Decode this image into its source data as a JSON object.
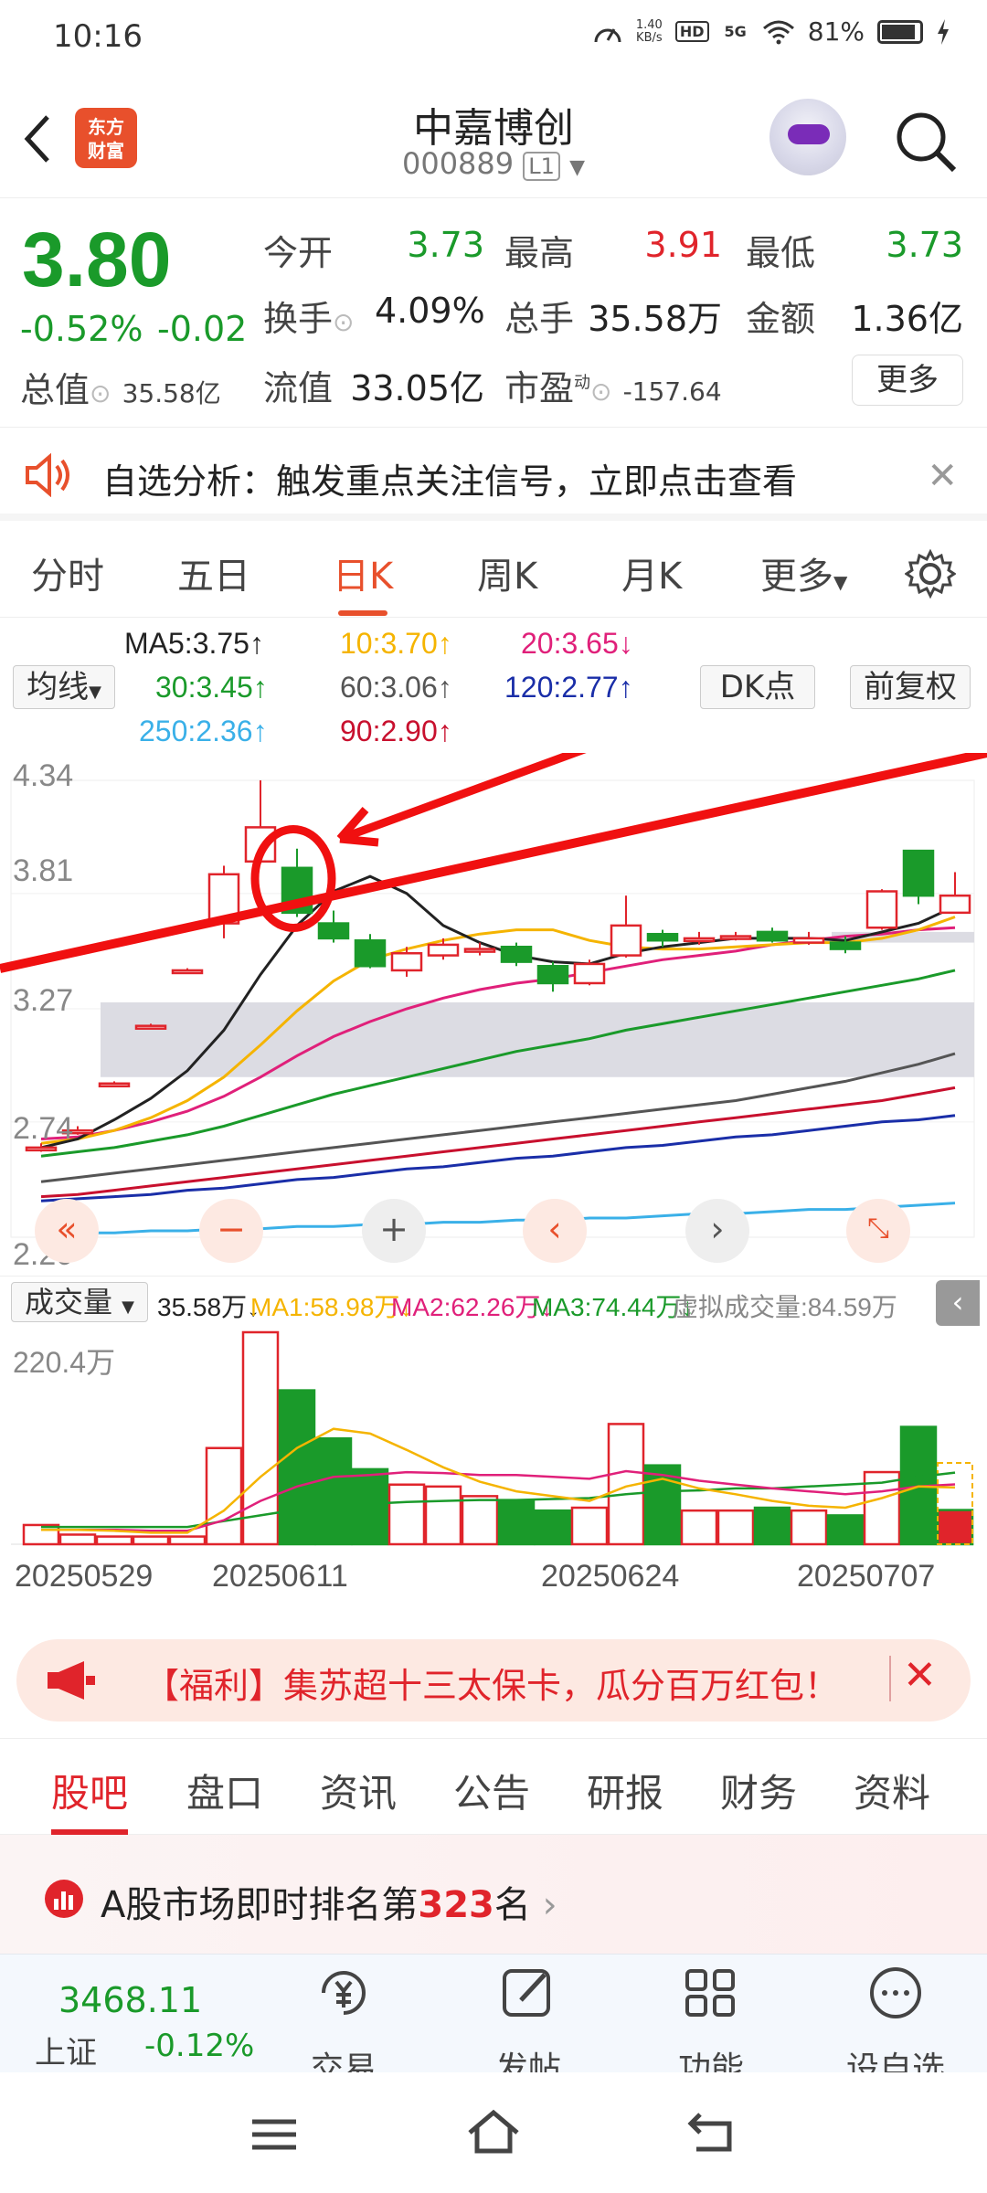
{
  "status": {
    "time": "10:16",
    "net_speed": "1.40",
    "net_unit": "KB/s",
    "hd": "HD",
    "signal": "5G",
    "battery": "81%"
  },
  "header": {
    "logo": "东方财富",
    "name": "中嘉博创",
    "code": "000889",
    "level": "L1"
  },
  "quote": {
    "price": "3.80",
    "change_pct": "-0.52%",
    "change": "-0.02",
    "open_label": "今开",
    "open": "3.73",
    "high_label": "最高",
    "high": "3.91",
    "low_label": "最低",
    "low": "3.73",
    "turnover_label": "换手",
    "turnover": "4.09%",
    "volume_label": "总手",
    "volume": "35.58万",
    "amount_label": "金额",
    "amount": "1.36亿",
    "mktcap_label": "总值",
    "mktcap": "35.58亿",
    "float_label": "流值",
    "float": "33.05亿",
    "pe_label": "市盈",
    "pe_sup": "动",
    "pe": "-157.64",
    "more": "更多"
  },
  "alert": {
    "text": "自选分析：触发重点关注信号，立即点击查看"
  },
  "ktabs": [
    "分时",
    "五日",
    "日K",
    "周K",
    "月K",
    "更多"
  ],
  "ktab_active": "日K",
  "ma_legend": {
    "selector": "均线",
    "ma5": "MA5:3.75↑",
    "ma10": "10:3.70↑",
    "ma20": "20:3.65↓",
    "ma30": "30:3.45↑",
    "ma60": "60:3.06↑",
    "ma120": "120:2.77↑",
    "ma250": "250:2.36↑",
    "ma90": "90:2.90↑",
    "dk": "DK点",
    "fq": "前复权"
  },
  "colors": {
    "up": "#e0242b",
    "down": "#1a9a2a",
    "ma5": "#222222",
    "ma10": "#f5b400",
    "ma20": "#e0207a",
    "ma30": "#1a9a2a",
    "ma60": "#555555",
    "ma120": "#1a2ea8",
    "ma250": "#3ab0e8",
    "ma90": "#c8102e"
  },
  "price_axis": [
    "4.34",
    "3.81",
    "3.27",
    "2.74",
    "2.20"
  ],
  "volume_bar": {
    "selector": "成交量",
    "vol": "35.58万↓",
    "ma1": "MA1:58.98万↓",
    "ma2": "MA2:62.26万↓",
    "ma3": "MA3:74.44万↓",
    "virtual": "虚拟成交量:84.59万"
  },
  "volume_axis": "220.4万",
  "dates": [
    "20250529",
    "20250611",
    "20250624",
    "20250707"
  ],
  "chart_data": {
    "type": "candlestick",
    "ylim": [
      2.2,
      4.34
    ],
    "candles": [
      {
        "o": 2.62,
        "c": 2.62,
        "h": 2.64,
        "l": 2.6
      },
      {
        "o": 2.7,
        "c": 2.7,
        "h": 2.72,
        "l": 2.68
      },
      {
        "o": 2.92,
        "c": 2.92,
        "h": 2.93,
        "l": 2.91
      },
      {
        "o": 3.19,
        "c": 3.19,
        "h": 3.2,
        "l": 3.18
      },
      {
        "o": 3.45,
        "c": 3.45,
        "h": 3.46,
        "l": 3.44
      },
      {
        "o": 3.67,
        "c": 3.9,
        "h": 3.94,
        "l": 3.6
      },
      {
        "o": 3.96,
        "c": 4.12,
        "h": 4.34,
        "l": 3.95
      },
      {
        "o": 3.93,
        "c": 3.72,
        "h": 4.02,
        "l": 3.7
      },
      {
        "o": 3.67,
        "c": 3.6,
        "h": 3.73,
        "l": 3.58
      },
      {
        "o": 3.59,
        "c": 3.47,
        "h": 3.62,
        "l": 3.46
      },
      {
        "o": 3.45,
        "c": 3.53,
        "h": 3.56,
        "l": 3.42
      },
      {
        "o": 3.52,
        "c": 3.57,
        "h": 3.6,
        "l": 3.5
      },
      {
        "o": 3.55,
        "c": 3.55,
        "h": 3.58,
        "l": 3.52
      },
      {
        "o": 3.56,
        "c": 3.49,
        "h": 3.58,
        "l": 3.47
      },
      {
        "o": 3.47,
        "c": 3.39,
        "h": 3.49,
        "l": 3.35
      },
      {
        "o": 3.39,
        "c": 3.48,
        "h": 3.5,
        "l": 3.38
      },
      {
        "o": 3.52,
        "c": 3.66,
        "h": 3.8,
        "l": 3.51
      },
      {
        "o": 3.62,
        "c": 3.59,
        "h": 3.64,
        "l": 3.56
      },
      {
        "o": 3.6,
        "c": 3.6,
        "h": 3.63,
        "l": 3.57
      },
      {
        "o": 3.61,
        "c": 3.61,
        "h": 3.63,
        "l": 3.59
      },
      {
        "o": 3.63,
        "c": 3.59,
        "h": 3.65,
        "l": 3.58
      },
      {
        "o": 3.58,
        "c": 3.6,
        "h": 3.63,
        "l": 3.57
      },
      {
        "o": 3.58,
        "c": 3.55,
        "h": 3.61,
        "l": 3.53
      },
      {
        "o": 3.65,
        "c": 3.82,
        "h": 3.83,
        "l": 3.64
      },
      {
        "o": 4.01,
        "c": 3.8,
        "h": 4.01,
        "l": 3.76
      },
      {
        "o": 3.72,
        "c": 3.8,
        "h": 3.91,
        "l": 3.73
      }
    ],
    "ma5": [
      2.62,
      2.66,
      2.75,
      2.85,
      2.98,
      3.17,
      3.43,
      3.66,
      3.82,
      3.89,
      3.81,
      3.66,
      3.58,
      3.52,
      3.49,
      3.48,
      3.53,
      3.56,
      3.58,
      3.6,
      3.6,
      3.6,
      3.59,
      3.63,
      3.67,
      3.75
    ],
    "ma10": [
      2.64,
      2.66,
      2.7,
      2.76,
      2.84,
      2.95,
      3.1,
      3.26,
      3.4,
      3.5,
      3.55,
      3.59,
      3.62,
      3.64,
      3.64,
      3.59,
      3.56,
      3.55,
      3.55,
      3.56,
      3.57,
      3.58,
      3.58,
      3.6,
      3.64,
      3.7
    ],
    "ma20": [
      2.66,
      2.67,
      2.7,
      2.74,
      2.79,
      2.86,
      2.95,
      3.05,
      3.14,
      3.21,
      3.27,
      3.32,
      3.36,
      3.39,
      3.41,
      3.44,
      3.47,
      3.5,
      3.52,
      3.54,
      3.57,
      3.59,
      3.61,
      3.62,
      3.64,
      3.65
    ],
    "ma30": [
      2.58,
      2.6,
      2.62,
      2.65,
      2.68,
      2.72,
      2.77,
      2.82,
      2.87,
      2.91,
      2.95,
      2.99,
      3.03,
      3.07,
      3.1,
      3.13,
      3.17,
      3.2,
      3.23,
      3.26,
      3.29,
      3.32,
      3.35,
      3.38,
      3.41,
      3.45
    ],
    "ma60": [
      2.46,
      2.48,
      2.5,
      2.52,
      2.54,
      2.56,
      2.58,
      2.6,
      2.62,
      2.64,
      2.66,
      2.68,
      2.7,
      2.72,
      2.74,
      2.76,
      2.78,
      2.8,
      2.82,
      2.84,
      2.87,
      2.9,
      2.93,
      2.97,
      3.01,
      3.06
    ],
    "ma90": [
      2.39,
      2.4,
      2.42,
      2.44,
      2.46,
      2.48,
      2.5,
      2.52,
      2.54,
      2.56,
      2.58,
      2.6,
      2.62,
      2.64,
      2.66,
      2.68,
      2.7,
      2.72,
      2.74,
      2.76,
      2.78,
      2.8,
      2.82,
      2.84,
      2.87,
      2.9
    ],
    "ma120": [
      2.37,
      2.38,
      2.39,
      2.4,
      2.42,
      2.43,
      2.45,
      2.47,
      2.48,
      2.5,
      2.52,
      2.53,
      2.55,
      2.57,
      2.58,
      2.6,
      2.62,
      2.63,
      2.65,
      2.67,
      2.68,
      2.7,
      2.72,
      2.74,
      2.75,
      2.77
    ],
    "ma250": [
      2.21,
      2.22,
      2.22,
      2.23,
      2.23,
      2.24,
      2.24,
      2.25,
      2.25,
      2.26,
      2.26,
      2.27,
      2.27,
      2.28,
      2.28,
      2.29,
      2.29,
      2.3,
      2.31,
      2.31,
      2.32,
      2.33,
      2.33,
      2.34,
      2.35,
      2.36
    ],
    "volume": [
      20,
      10,
      8,
      8,
      8,
      100,
      220.4,
      160,
      110,
      78,
      62,
      60,
      50,
      45,
      35,
      38,
      125,
      82,
      35,
      35,
      38,
      35,
      30,
      75,
      122,
      35.58
    ],
    "vol_ma1": [
      15,
      15,
      14,
      12,
      12,
      35,
      70,
      100,
      120,
      115,
      98,
      80,
      65,
      55,
      50,
      45,
      60,
      68,
      58,
      52,
      45,
      40,
      38,
      48,
      60,
      58.98
    ],
    "vol_ma2": [
      15,
      15,
      15,
      14,
      14,
      25,
      45,
      60,
      70,
      72,
      75,
      74,
      72,
      72,
      70,
      68,
      76,
      72,
      66,
      62,
      58,
      55,
      52,
      55,
      60,
      62.26
    ],
    "vol_ma3": [
      18,
      18,
      18,
      18,
      18,
      24,
      30,
      36,
      40,
      42,
      44,
      45,
      46,
      46,
      47,
      48,
      52,
      55,
      56,
      58,
      58,
      60,
      62,
      64,
      70,
      74.44
    ]
  }
}
